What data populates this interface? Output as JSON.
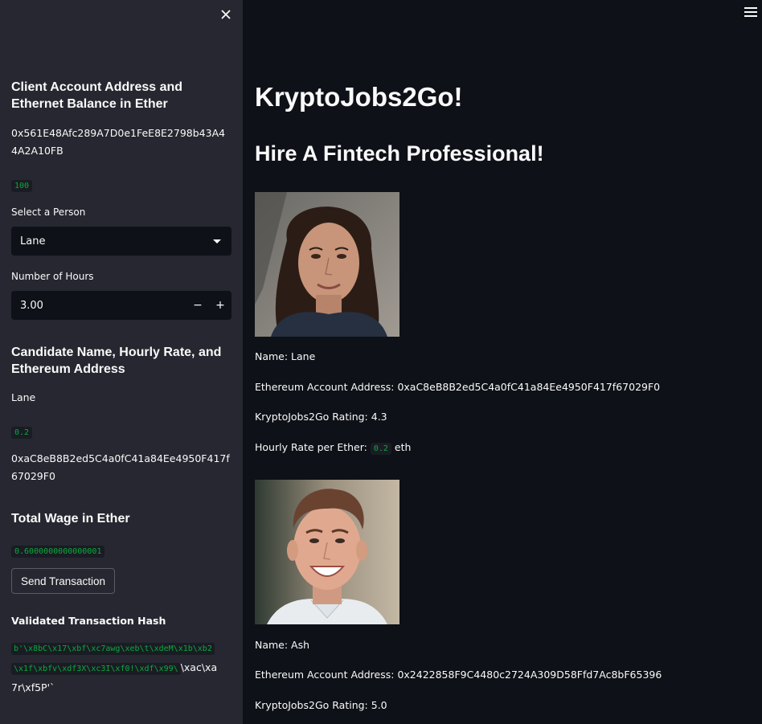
{
  "sidebar": {
    "account_heading": "Client Account Address and Ethernet Balance in Ether",
    "account_address": "0x561E48Afc289A7D0e1FeE8E2798b43A44A2A10FB",
    "balance": "100",
    "select_label": "Select a Person",
    "select_value": "Lane",
    "hours_label": "Number of Hours",
    "hours_value": "3.00",
    "hours_minus": "−",
    "hours_plus": "+",
    "candidate_heading": "Candidate Name, Hourly Rate, and Ethereum Address",
    "candidate_name": "Lane",
    "candidate_rate": "0.2",
    "candidate_address": "0xaC8eB8B2ed5C4a0fC41a84Ee4950F417f67029F0",
    "wage_heading": "Total Wage in Ether",
    "wage_value": "0.6000000000000001",
    "send_button": "Send Transaction",
    "hash_heading": "Validated Transaction Hash",
    "hash_line1": "b'\\x8bC\\x17\\xbf\\xc7awg\\xeb\\t\\xdeM\\x1b\\xb2",
    "hash_line2": "\\x1f\\xbfv\\xdf3X\\xc3I\\xf0!\\xdf\\x99\\",
    "hash_line2_plain": "\\xac\\xa",
    "hash_line3_plain": "7r\\xf5P'`"
  },
  "main": {
    "title": "KryptoJobs2Go!",
    "subtitle": "Hire A Fintech Professional!",
    "candidates": [
      {
        "name_line": "Name: Lane",
        "address_line": "Ethereum Account Address: 0xaC8eB8B2ed5C4a0fC41a84Ee4950F417f67029F0",
        "rating_line": "KryptoJobs2Go Rating: 4.3",
        "rate_prefix": "Hourly Rate per Ether:",
        "rate_value": "0.2",
        "rate_suffix": "eth"
      },
      {
        "name_line": "Name: Ash",
        "address_line": "Ethereum Account Address: 0x2422858F9C4480c2724A309D58Ffd7Ac8bF65396",
        "rating_line": "KryptoJobs2Go Rating: 5.0"
      }
    ]
  },
  "colors": {
    "main_bg": "#0e1117",
    "sidebar_bg": "#262730",
    "code_green": "#09ab3b"
  }
}
